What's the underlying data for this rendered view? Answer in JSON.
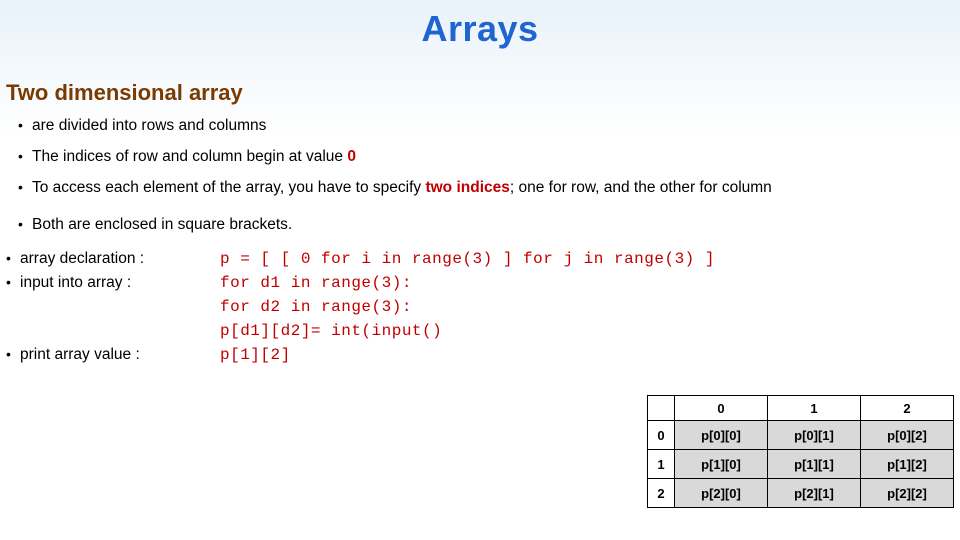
{
  "title": "Arrays",
  "subheading": "Two dimensional array",
  "bullets": {
    "b1": "are divided into rows and columns",
    "b2a": "The indices of row and column begin at value ",
    "b2b": "0",
    "b3a": "To access each element of the array, you have to specify ",
    "b3b": "two indices",
    "b3c": "; one for row, and the other for column",
    "b4": "Both are enclosed in square brackets."
  },
  "examples": {
    "decl_label": "array declaration :",
    "decl_code": "p = [ [ 0 for i in range(3) ] for j in range(3) ]",
    "input_label": "input into array :",
    "input_code1": "for d1 in range(3):",
    "input_code2": "for d2 in range(3):",
    "input_code3": "p[d1][d2]= int(input()",
    "print_label": "print array value :",
    "print_code": "p[1][2]"
  },
  "table": {
    "col0": "0",
    "col1": "1",
    "col2": "2",
    "row0": "0",
    "row1": "1",
    "row2": "2",
    "c00": "p[0][0]",
    "c01": "p[0][1]",
    "c02": "p[0][2]",
    "c10": "p[1][0]",
    "c11": "p[1][1]",
    "c12": "p[1][2]",
    "c20": "p[2][0]",
    "c21": "p[2][1]",
    "c22": "p[2][2]"
  }
}
